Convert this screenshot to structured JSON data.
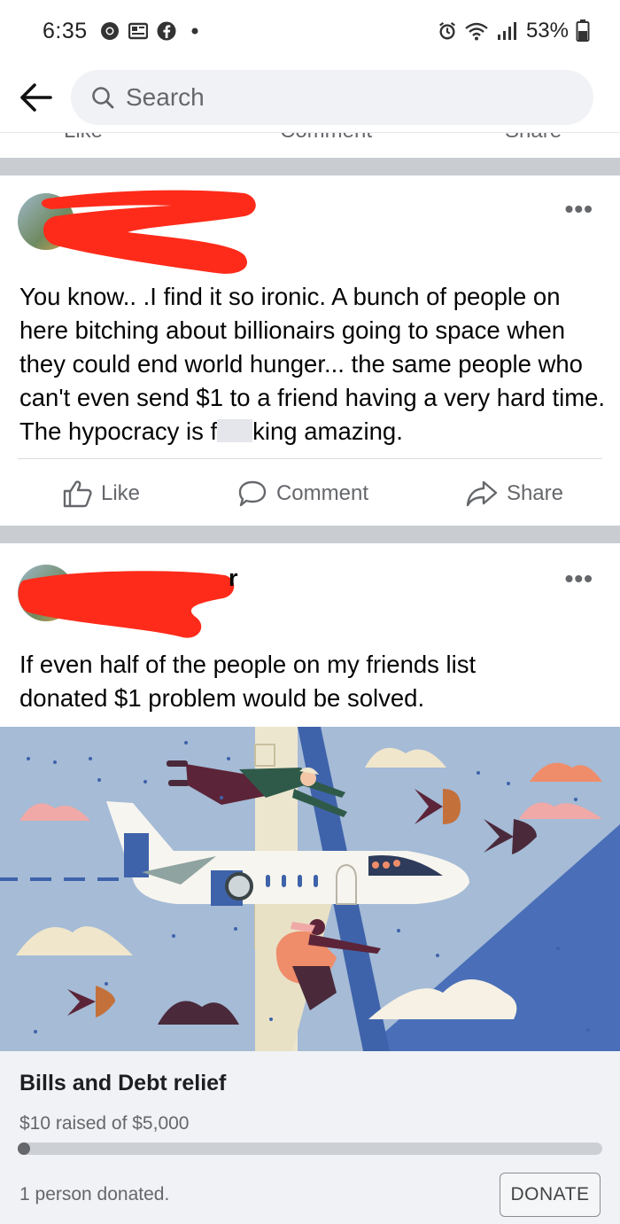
{
  "status_bar": {
    "time": "6:35",
    "battery": "53%",
    "icons_left": [
      "chrome-icon",
      "news-icon",
      "facebook-icon",
      "dot-icon"
    ],
    "icons_right": [
      "alarm-icon",
      "wifi-icon",
      "signal-icon",
      "battery-icon"
    ]
  },
  "header": {
    "back_icon": "arrow-left-icon",
    "search_placeholder": "Search"
  },
  "previous_actions": [
    "Like",
    "Comment",
    "Share"
  ],
  "posts": [
    {
      "author": "",
      "author_visible_fragment": "",
      "text_before_censor": "You know.. .I find it so ironic. A bunch of people on here bitching about billionairs going to space when they could end world hunger... the same people who can't even send $1 to a friend having a very hard time. The hypocracy is f",
      "text_after_censor": "king amazing.",
      "actions": {
        "like": "Like",
        "comment": "Comment",
        "share": "Share"
      },
      "more": "•••"
    },
    {
      "author_visible_fragment": "r",
      "text": "If even half of the people on my friends list donated $1 problem would be solved.",
      "more": "•••"
    }
  ],
  "fundraiser": {
    "title": "Bills and Debt relief",
    "raised_text": "$10 raised of $5,000",
    "raised": 10,
    "goal": 5000,
    "donors_text": "1 person donated.",
    "donate_label": "DONATE"
  },
  "colors": {
    "redaction": "#fe2b1a",
    "divider": "#c9ccd1",
    "sky": "#a5bbd6",
    "deep_blue": "#4a6fb8"
  }
}
